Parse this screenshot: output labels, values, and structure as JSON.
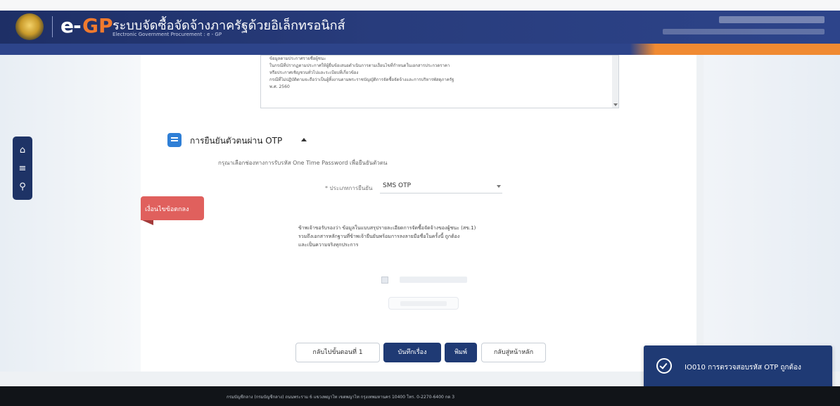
{
  "header": {
    "logo_e": "e-",
    "logo_gp": "GP",
    "system_title": "ระบบจัดซื้อจัดจ้างภาครัฐด้วยอิเล็กทรอนิกส์",
    "system_subtitle": "Electronic Government Procurement : e - GP"
  },
  "document": {
    "lines": [
      "ข้อมูลตามประกาศรายชื่อผู้ชนะ",
      "ในกรณีที่ปรากฏตามประกาศให้ผู้ยื่นข้อเสนอดำเนินการตามเงื่อนไขที่กำหนดในเอกสารประกวดราคา",
      "หรือประกาศเชิญชวนทั่วไปและระเบียบที่เกี่ยวข้อง",
      "กรณีที่ไม่ปฏิบัติตามจะถือว่าเป็นผู้ทิ้งงานตามพระราชบัญญัติการจัดซื้อจัดจ้างและการบริหารพัสดุภาครัฐ",
      "พ.ศ. 2560"
    ]
  },
  "side_menu": {
    "home_icon": "home-icon",
    "menu_icon": "menu-icon",
    "search_icon": "search-icon"
  },
  "otp_section": {
    "title": "การยืนยันตัวตนผ่าน OTP",
    "instruction": "กรุณาเลือกช่องทางการรับรหัส One Time Password เพื่อยืนยันตัวตน",
    "channel_label": "* ประเภทการยืนยัน",
    "channel_value": "SMS OTP"
  },
  "ribbon": {
    "label": "เงื่อนไขข้อตกลง"
  },
  "consent": {
    "lines": [
      "ข้าพเจ้าขอรับรองว่า ข้อมูลในแบบสรุปรายละเอียดการจัดซื้อจัดจ้างของผู้ชนะ (สข.1)",
      "รวมถึงเอกสารหลักฐานที่ข้าพเจ้ายืนยันพร้อมการลงลายมือชื่อในครั้งนี้ ถูกต้อง",
      "และเป็นความจริงทุกประการ"
    ]
  },
  "buttons": {
    "back_step1": "กลับไปขั้นตอนที่ 1",
    "save": "บันทึกเรื่อง",
    "print": "พิมพ์",
    "home": "กลับสู่หน้าหลัก"
  },
  "toast": {
    "message": "IO010 การตรวจสอบรหัส OTP ถูกต้อง"
  },
  "footer": {
    "text": "กรมบัญชีกลาง (กรมบัญชีกลาง) ถนนพระราม 6 แขวงพญาไท เขตพญาไท กรุงเทพมหานคร 10400 โทร. 0-2270-6400 กด 3"
  }
}
